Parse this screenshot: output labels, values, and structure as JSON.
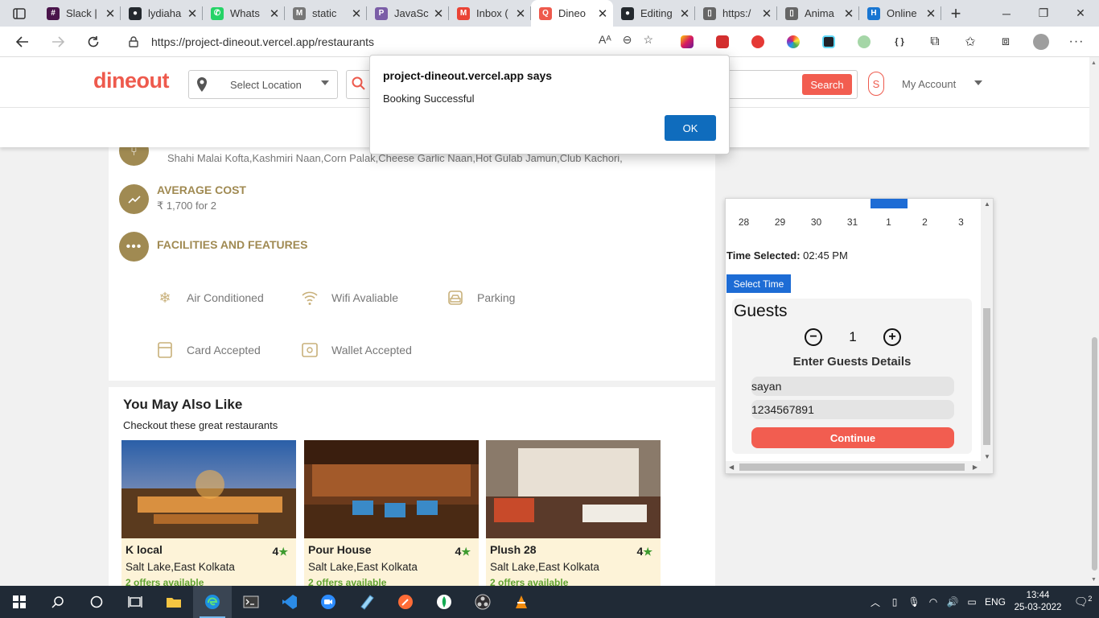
{
  "browser": {
    "tabs": [
      {
        "title": "Slack |",
        "color": "#4a154b",
        "glyph": "#"
      },
      {
        "title": "lydiaha",
        "color": "#24292e",
        "glyph": "●"
      },
      {
        "title": "Whats",
        "color": "#25d366",
        "glyph": "✆"
      },
      {
        "title": "static",
        "color": "#777777",
        "glyph": "M"
      },
      {
        "title": "JavaSc",
        "color": "#7b5ea7",
        "glyph": "P"
      },
      {
        "title": "Inbox (",
        "color": "#ea4335",
        "glyph": "M"
      },
      {
        "title": "Dineo",
        "color": "#ee5a4d",
        "glyph": "Q",
        "active": true
      },
      {
        "title": "Editing",
        "color": "#24292e",
        "glyph": "●"
      },
      {
        "title": "https:/",
        "color": "#666666",
        "glyph": "▯"
      },
      {
        "title": "Anima",
        "color": "#666666",
        "glyph": "▯"
      },
      {
        "title": "Online",
        "color": "#1976d2",
        "glyph": "H"
      }
    ],
    "url_host": "https://project-dineout.vercel.app",
    "url_path": "/restaurants"
  },
  "site": {
    "logo": "dineout",
    "location_placeholder": "Select Location",
    "search_button": "Search",
    "avatar_letter": "S",
    "account_label": "My Account"
  },
  "details": {
    "dishes": "Shahi Malai Kofta,Kashmiri Naan,Corn Palak,Cheese Garlic Naan,Hot Gulab Jamun,Club Kachori,",
    "avg_cost_title": "AVERAGE COST",
    "avg_cost_value": "₹ 1,700 for 2",
    "facilities_title": "FACILITIES AND FEATURES",
    "facilities": [
      {
        "label": "Air Conditioned",
        "icon": "snowflake-icon"
      },
      {
        "label": "Wifi Avaliable",
        "icon": "wifi-icon"
      },
      {
        "label": "Parking",
        "icon": "car-icon"
      },
      {
        "label": "Card Accepted",
        "icon": "card-icon"
      },
      {
        "label": "Wallet Accepted",
        "icon": "wallet-icon"
      }
    ]
  },
  "also_like": {
    "title": "You May Also Like",
    "subtitle": "Checkout these great restaurants",
    "restaurants": [
      {
        "name": "K local",
        "rating": "4",
        "location": "Salt Lake,East Kolkata",
        "offers": "2 offers available"
      },
      {
        "name": "Pour House",
        "rating": "4",
        "location": "Salt Lake,East Kolkata",
        "offers": "2 offers available"
      },
      {
        "name": "Plush 28",
        "rating": "4",
        "location": "Salt Lake,East Kolkata",
        "offers": "2 offers available"
      }
    ]
  },
  "booking": {
    "dates": [
      "28",
      "29",
      "30",
      "31",
      "1",
      "2",
      "3"
    ],
    "time_label": "Time Selected:",
    "time_value": "02:45 PM",
    "select_time_button": "Select Time",
    "guests_title": "Guests",
    "guest_count": "1",
    "guest_details_title": "Enter Guests Details",
    "name_value": "sayan",
    "phone_value": "1234567891",
    "continue_button": "Continue"
  },
  "alert": {
    "title": "project-dineout.vercel.app says",
    "message": "Booking Successful",
    "ok_button": "OK"
  },
  "taskbar": {
    "language": "ENG",
    "time": "13:44",
    "date": "25-03-2022",
    "notification_count": "2"
  }
}
